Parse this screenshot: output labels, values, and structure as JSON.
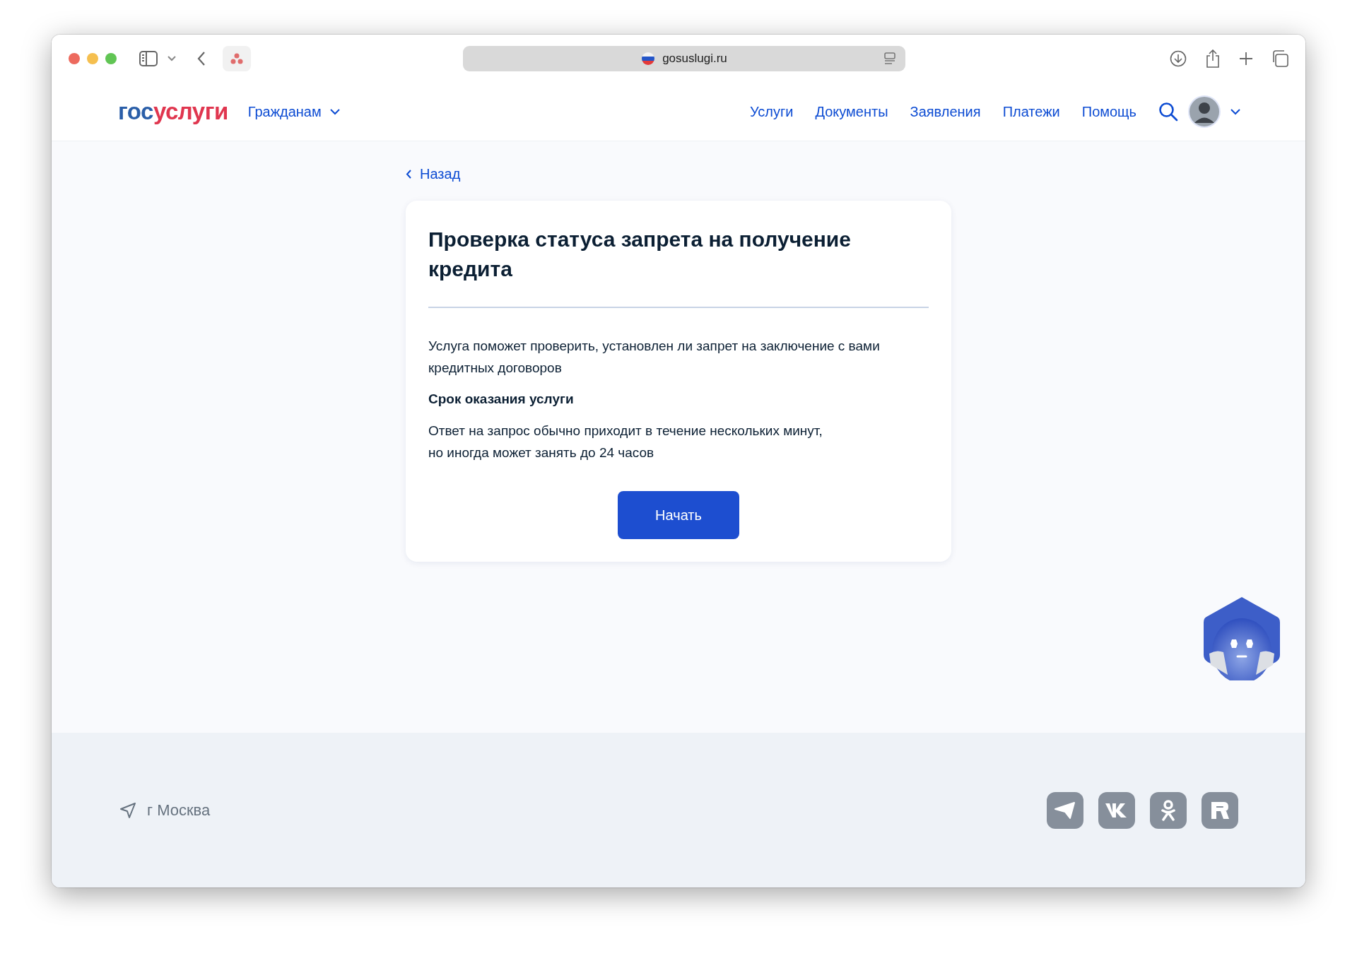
{
  "browser": {
    "url": "gosuslugi.ru"
  },
  "header": {
    "logo": {
      "first": "гос",
      "second": "услуги"
    },
    "audience": "Гражданам",
    "nav": [
      {
        "label": "Услуги"
      },
      {
        "label": "Документы"
      },
      {
        "label": "Заявления"
      },
      {
        "label": "Платежи"
      },
      {
        "label": "Помощь"
      }
    ]
  },
  "back": "Назад",
  "card": {
    "title": "Проверка статуса запрета на получение кредита",
    "description": "Услуга поможет проверить, установлен ли запрет на заключение с вами кредитных договоров",
    "term_heading": "Срок оказания услуги",
    "term_text": "Ответ на запрос обычно приходит в течение нескольких минут,\nно иногда может занять до 24 часов",
    "button": "Начать"
  },
  "footer": {
    "location": "г Москва",
    "socials": [
      {
        "kind": "telegram"
      },
      {
        "kind": "vk"
      },
      {
        "kind": "ok"
      },
      {
        "kind": "rutube"
      }
    ]
  }
}
